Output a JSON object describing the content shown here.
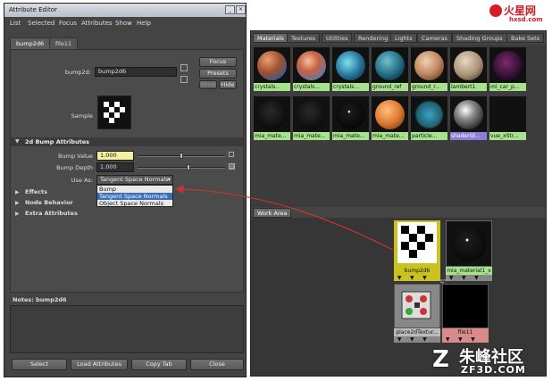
{
  "attribute_editor": {
    "title": "Attribute Editor",
    "menu": [
      "List",
      "Selected",
      "Focus",
      "Attributes",
      "Show",
      "Help"
    ],
    "tabs": [
      "bump2d6",
      "file11"
    ],
    "node_label": "bump2d:",
    "node_value": "bump2d6",
    "focus_button": "Focus",
    "presets_button": "Presets",
    "show_button": "Show",
    "hide_button": "Hide",
    "sample_label": "Sample",
    "section_bump": "2d Bump Attributes",
    "bump_value_label": "Bump Value",
    "bump_value": "1.000",
    "bump_depth_label": "Bump Depth",
    "bump_depth": "1.000",
    "use_as_label": "Use As:",
    "use_as_value": "Tangent Space Normals",
    "use_as_options": [
      "Bump",
      "Tangent Space Normals",
      "Object Space Normals"
    ],
    "sections": [
      "Effects",
      "Node Behavior",
      "Extra Attributes"
    ],
    "notes_label": "Notes:  bump2d6",
    "bottom_buttons": [
      "Select",
      "Load Attributes",
      "Copy Tab",
      "Close"
    ]
  },
  "hypershade": {
    "tabs": [
      "Materials",
      "Textures",
      "Utilities",
      "Rendering",
      "Lights",
      "Cameras",
      "Shading Groups",
      "Bake Sets"
    ],
    "swatches_row1": [
      "crystals...",
      "crystals...",
      "crystals...",
      "ground_ref",
      "ground_r...",
      "lambert1",
      "mi_car_p..."
    ],
    "swatches_row2": [
      "mia_mate...",
      "mia_mate...",
      "mia_mate...",
      "mia_mate...",
      "particle...",
      "shaderGl...",
      "vue_xStr..."
    ],
    "work_area_tab": "Work Area",
    "nodes": [
      "bump2d6",
      "mia_material1_x",
      "place2dTextur...",
      "file11"
    ]
  },
  "watermarks": {
    "top_right_cn": "火星网",
    "top_right_url": "hxsd.com",
    "bottom_right_cn": "朱峰社区",
    "bottom_right_url": "ZF3D.COM"
  },
  "colors": {
    "caption_green": "#a6e38c",
    "bump_node": "#c9c21f",
    "file_node": "#d98b8b",
    "arrow": "#c0392b"
  }
}
